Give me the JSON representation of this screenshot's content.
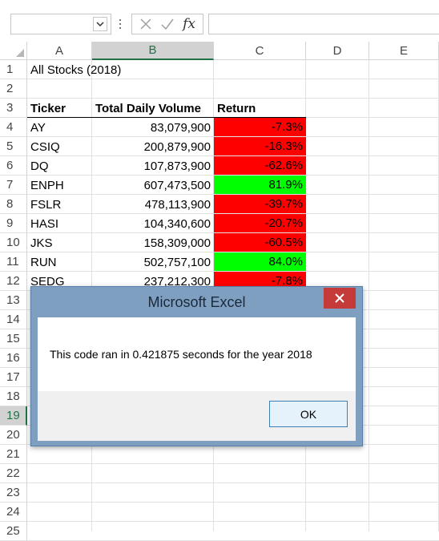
{
  "formula_bar": {
    "name_box_value": "",
    "formula_value": "",
    "fx_label": "fx"
  },
  "columns": [
    "A",
    "B",
    "C",
    "D",
    "E"
  ],
  "selected_column": "B",
  "rows": [
    "1",
    "2",
    "3",
    "4",
    "5",
    "6",
    "7",
    "8",
    "9",
    "10",
    "11",
    "12",
    "13",
    "14",
    "15",
    "16",
    "17",
    "18",
    "19",
    "20",
    "21",
    "22",
    "23",
    "24",
    "25"
  ],
  "selected_row": "19",
  "sheet": {
    "title": "All Stocks (2018)",
    "headers": {
      "ticker": "Ticker",
      "volume": "Total Daily Volume",
      "return": "Return"
    },
    "data": [
      {
        "ticker": "AY",
        "volume": "83,079,900",
        "return": "-7.3%",
        "positive": false
      },
      {
        "ticker": "CSIQ",
        "volume": "200,879,900",
        "return": "-16.3%",
        "positive": false
      },
      {
        "ticker": "DQ",
        "volume": "107,873,900",
        "return": "-62.6%",
        "positive": false
      },
      {
        "ticker": "ENPH",
        "volume": "607,473,500",
        "return": "81.9%",
        "positive": true
      },
      {
        "ticker": "FSLR",
        "volume": "478,113,900",
        "return": "-39.7%",
        "positive": false
      },
      {
        "ticker": "HASI",
        "volume": "104,340,600",
        "return": "-20.7%",
        "positive": false
      },
      {
        "ticker": "JKS",
        "volume": "158,309,000",
        "return": "-60.5%",
        "positive": false
      },
      {
        "ticker": "RUN",
        "volume": "502,757,100",
        "return": "84.0%",
        "positive": true
      },
      {
        "ticker": "SEDG",
        "volume": "237,212,300",
        "return": "-7.8%",
        "positive": false
      }
    ]
  },
  "colors": {
    "negative_fill": "#ff0000",
    "positive_fill": "#00ff00",
    "accent_green": "#217346"
  },
  "dialog": {
    "title": "Microsoft Excel",
    "message": "This code ran in 0.421875 seconds for the year 2018",
    "ok_label": "OK"
  }
}
